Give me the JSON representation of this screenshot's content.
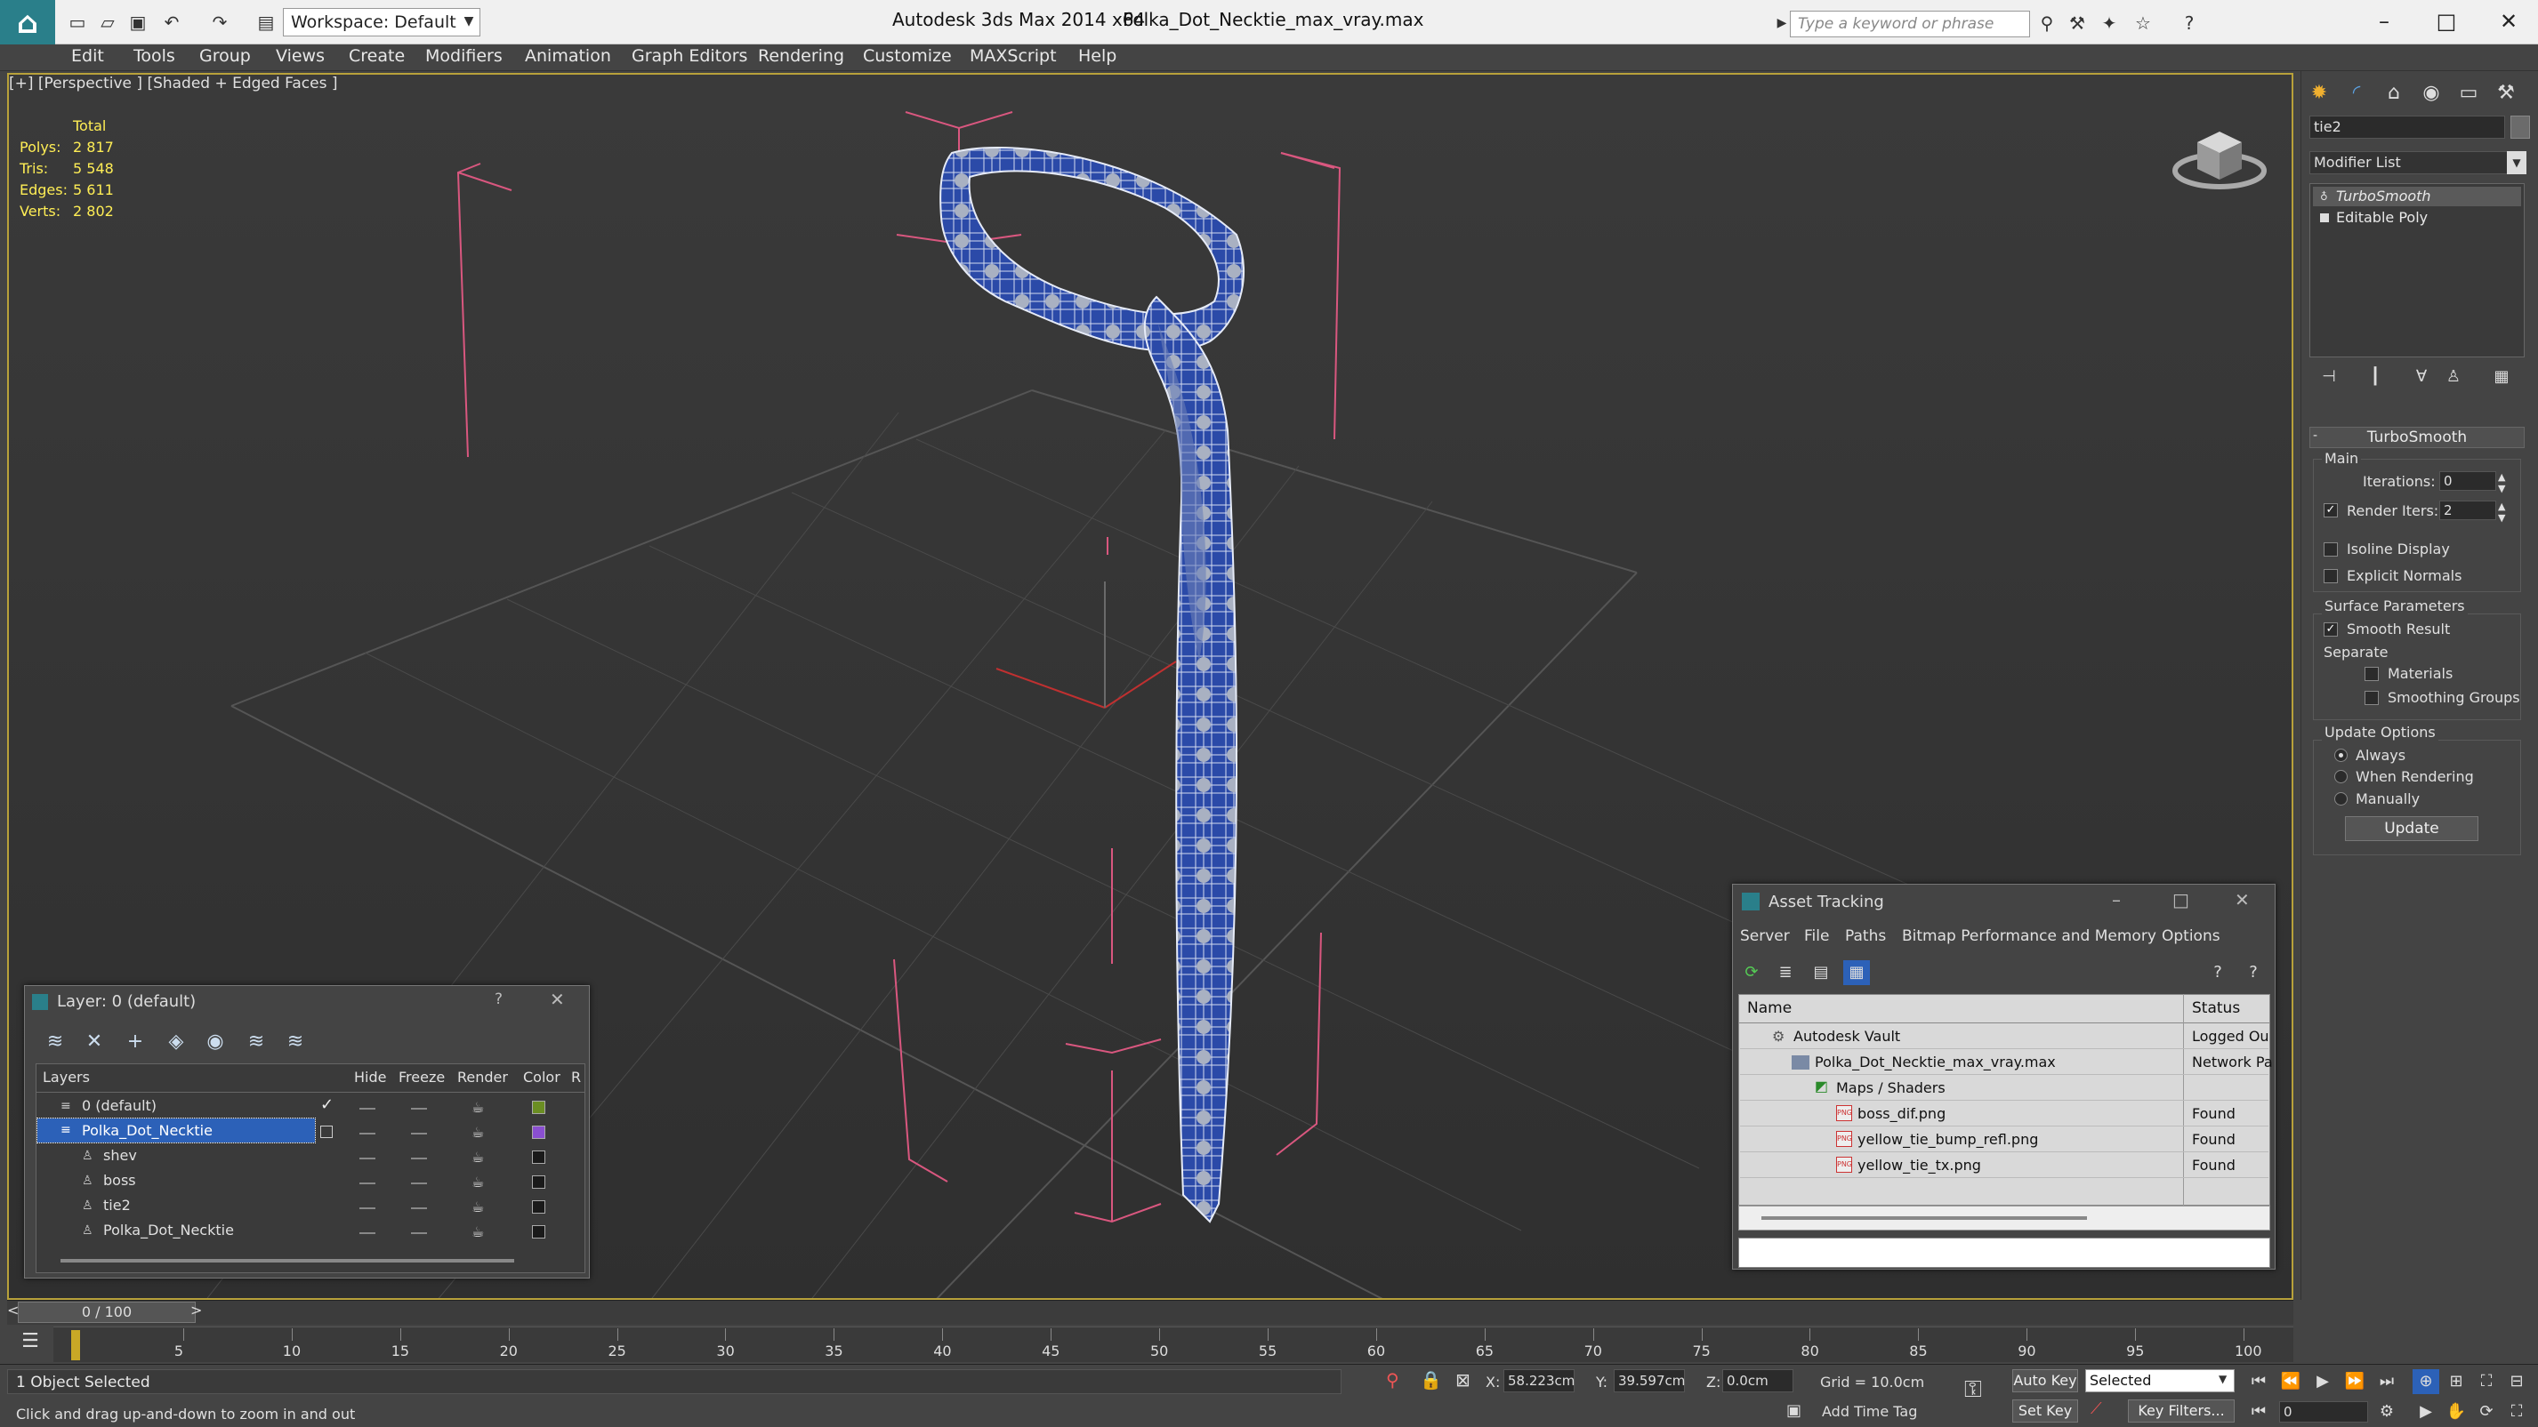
{
  "titlebar": {
    "workspace": "Workspace: Default",
    "app_title": "Autodesk 3ds Max  2014 x64",
    "file_title": "Polka_Dot_Necktie_max_vray.max",
    "search_placeholder": "Type a keyword or phrase"
  },
  "menu": [
    "Edit",
    "Tools",
    "Group",
    "Views",
    "Create",
    "Modifiers",
    "Animation",
    "Graph Editors",
    "Rendering",
    "Customize",
    "MAXScript",
    "Help"
  ],
  "viewport": {
    "label": "[+] [Perspective ] [Shaded + Edged Faces ]",
    "stats_header": "Total",
    "stats": [
      {
        "label": "Polys:",
        "value": "2 817"
      },
      {
        "label": "Tris:",
        "value": "5 548"
      },
      {
        "label": "Edges:",
        "value": "5 611"
      },
      {
        "label": "Verts:",
        "value": "2 802"
      }
    ]
  },
  "command_panel": {
    "object_name": "tie2",
    "modifier_list": "Modifier List",
    "stack": [
      "TurboSmooth",
      "Editable Poly"
    ],
    "rollout_title": "TurboSmooth",
    "main_group": "Main",
    "iterations_label": "Iterations:",
    "iterations_value": "0",
    "render_iters_label": "Render Iters:",
    "render_iters_value": "2",
    "isoline_label": "Isoline Display",
    "explicit_normals_label": "Explicit Normals",
    "surface_params_label": "Surface Parameters",
    "smooth_result_label": "Smooth Result",
    "separate_label": "Separate",
    "materials_label": "Materials",
    "smoothing_groups_label": "Smoothing Groups",
    "update_options_label": "Update Options",
    "always_label": "Always",
    "when_rendering_label": "When Rendering",
    "manually_label": "Manually",
    "update_button": "Update"
  },
  "layer_dialog": {
    "title": "Layer: 0 (default)",
    "help": "?",
    "columns": [
      "Layers",
      "Hide",
      "Freeze",
      "Render",
      "Color",
      "R"
    ],
    "rows": [
      {
        "name": "0 (default)",
        "color": "#6b8e23",
        "selected": false,
        "indent": 0,
        "active": true
      },
      {
        "name": "Polka_Dot_Necktie",
        "color": "#8a4fd0",
        "selected": true,
        "indent": 0,
        "active": false
      },
      {
        "name": "shev",
        "color": "#1a1a1a",
        "selected": false,
        "indent": 1,
        "active": false
      },
      {
        "name": "boss",
        "color": "#1a1a1a",
        "selected": false,
        "indent": 1,
        "active": false
      },
      {
        "name": "tie2",
        "color": "#1a1a1a",
        "selected": false,
        "indent": 1,
        "active": false
      },
      {
        "name": "Polka_Dot_Necktie",
        "color": "#1a1a1a",
        "selected": false,
        "indent": 1,
        "active": false
      }
    ]
  },
  "asset_dialog": {
    "title": "Asset Tracking",
    "menu": [
      "Server",
      "File",
      "Paths",
      "Bitmap Performance and Memory",
      "Options"
    ],
    "col_name": "Name",
    "col_status": "Status",
    "rows": [
      {
        "name": "Autodesk Vault",
        "status": "Logged Ou"
      },
      {
        "name": "Polka_Dot_Necktie_max_vray.max",
        "status": "Network Pa"
      },
      {
        "name": "Maps / Shaders",
        "status": ""
      },
      {
        "name": "boss_dif.png",
        "status": "Found"
      },
      {
        "name": "yellow_tie_bump_refl.png",
        "status": "Found"
      },
      {
        "name": "yellow_tie_tx.png",
        "status": "Found"
      }
    ]
  },
  "timeline": {
    "frame_display": "0 / 100",
    "ticks": [
      "5",
      "10",
      "15",
      "20",
      "25",
      "30",
      "35",
      "40",
      "45",
      "50",
      "55",
      "60",
      "65",
      "70",
      "75",
      "80",
      "85",
      "90",
      "95",
      "100"
    ]
  },
  "statusbar": {
    "selection": "1 Object Selected",
    "hint": "Click and drag up-and-down to zoom in and out",
    "x_label": "X:",
    "x_value": "58.223cm",
    "y_label": "Y:",
    "y_value": "39.597cm",
    "z_label": "Z:",
    "z_value": "0.0cm",
    "grid": "Grid = 10.0cm",
    "auto_key": "Auto Key",
    "selected": "Selected",
    "set_key": "Set Key",
    "key_filters": "Key Filters...",
    "add_time_tag": "Add Time Tag",
    "frame": "0"
  },
  "colors": {
    "accent_yellow": "#ffee55",
    "selection_blue": "#2c61b8",
    "tie_blue": "#2b4aa8",
    "gizmo_pink": "#d9577f"
  }
}
